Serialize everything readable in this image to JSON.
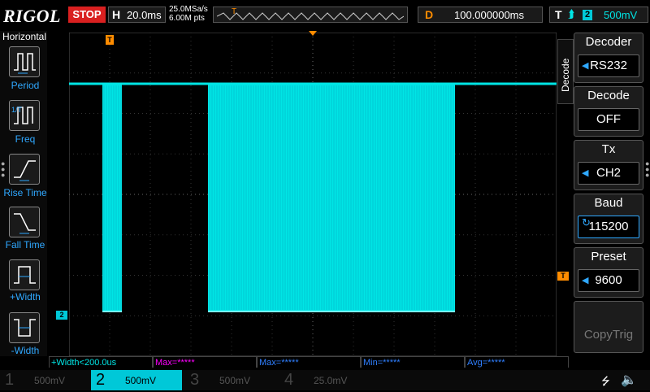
{
  "header": {
    "logo": "RIGOL",
    "run_state": "STOP",
    "horizontal": {
      "key": "H",
      "value": "20.0ms"
    },
    "sample_rate": "25.0MSa/s",
    "memory_depth": "6.00M pts",
    "trigger_marker": "T",
    "delay": {
      "key": "D",
      "value": "100.000000ms"
    },
    "trigger": {
      "key": "T",
      "edge_symbol": "⮭",
      "channel": "2",
      "level": "500mV"
    }
  },
  "left_menu": {
    "title": "Horizontal",
    "items": [
      {
        "label": "Period"
      },
      {
        "label": "Freq"
      },
      {
        "label": "Rise Time"
      },
      {
        "label": "Fall Time"
      },
      {
        "label": "+Width"
      },
      {
        "label": "-Width"
      }
    ]
  },
  "right_menu": {
    "tab": "Decode",
    "items": [
      {
        "title": "Decoder",
        "value": "RS232"
      },
      {
        "title": "Decode",
        "value": "OFF"
      },
      {
        "title": "Tx",
        "value": "CH2"
      },
      {
        "title": "Baud",
        "value": "115200"
      },
      {
        "title": "Preset",
        "value": "9600"
      },
      {
        "title": "",
        "value": "CopyTrig"
      }
    ]
  },
  "markers": {
    "trigger_top": "T",
    "trigger_level": "T",
    "ch2_ground": "2"
  },
  "measurements": [
    {
      "text": "+Width<200.0us",
      "color": "#00e5e5"
    },
    {
      "text": "Max=*****",
      "color": "#ff00ff"
    },
    {
      "text": "Max=*****",
      "color": "#2f7fff"
    },
    {
      "text": "Min=*****",
      "color": "#2f7fff"
    },
    {
      "text": "Avg=*****",
      "color": "#2f7fff"
    }
  ],
  "channels": [
    {
      "num": "1",
      "scale": "500mV"
    },
    {
      "num": "2",
      "scale": "500mV"
    },
    {
      "num": "3",
      "scale": "500mV"
    },
    {
      "num": "4",
      "scale": "25.0mV"
    }
  ],
  "colors": {
    "ch2": "#00e5e5",
    "trigger": "#ff8c00",
    "menu_blue": "#2fa8ff"
  },
  "waveform": {
    "channel": "2",
    "high_level": "idle high",
    "bursts": [
      {
        "start_div": 0.82,
        "end_div": 1.3
      },
      {
        "start_div": 3.42,
        "end_div": 9.5
      }
    ]
  }
}
